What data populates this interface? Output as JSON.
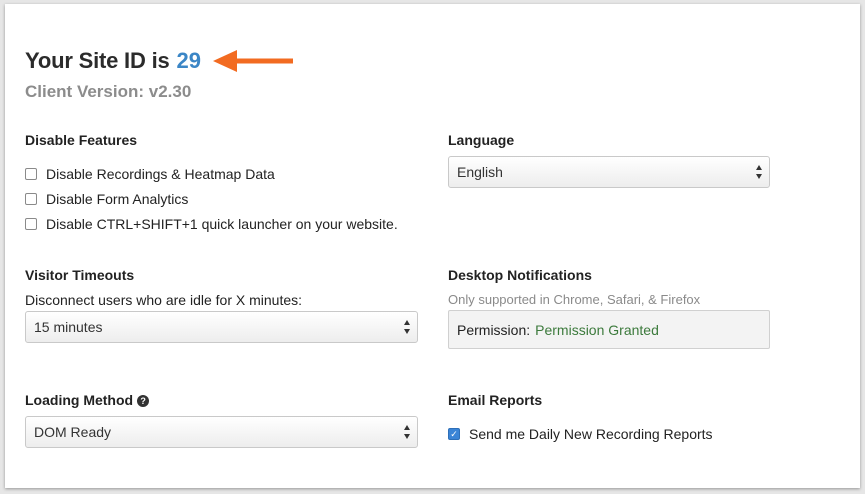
{
  "header": {
    "site_title": "Your Site ID is",
    "site_id": "29",
    "client_version": "Client Version: v2.30",
    "arrow_color": "#f26b21",
    "site_id_color": "#3b86c6"
  },
  "disable_features": {
    "title": "Disable Features",
    "options": [
      {
        "label": "Disable Recordings & Heatmap Data",
        "checked": false
      },
      {
        "label": "Disable Form Analytics",
        "checked": false
      },
      {
        "label": "Disable CTRL+SHIFT+1 quick launcher on your website.",
        "checked": false
      }
    ]
  },
  "language": {
    "title": "Language",
    "selected": "English"
  },
  "visitor_timeouts": {
    "title": "Visitor Timeouts",
    "description": "Disconnect users who are idle for X minutes:",
    "selected": "15 minutes"
  },
  "desktop_notifications": {
    "title": "Desktop Notifications",
    "note": "Only supported in Chrome, Safari, & Firefox",
    "permission_label": "Permission:",
    "permission_value": "Permission Granted",
    "permission_color": "#3c7a3c"
  },
  "loading_method": {
    "title": "Loading Method",
    "help_icon": "question-circle-icon",
    "selected": "DOM Ready"
  },
  "email_reports": {
    "title": "Email Reports",
    "option": {
      "label": "Send me Daily New Recording Reports",
      "checked": true
    }
  }
}
